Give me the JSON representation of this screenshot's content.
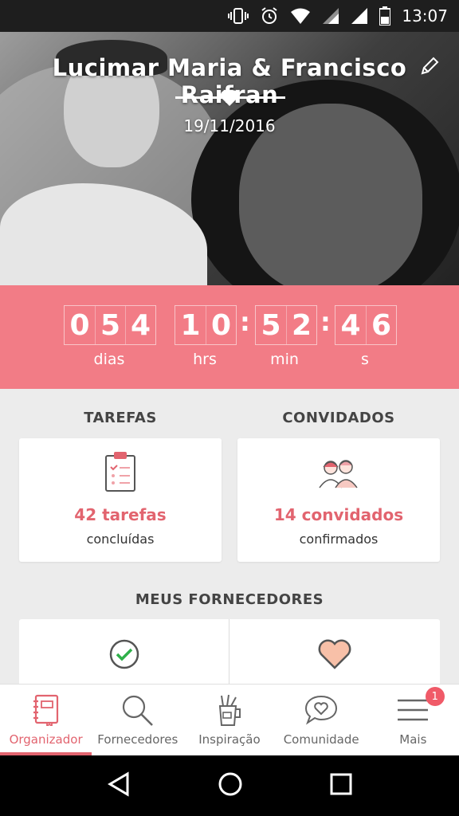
{
  "status_bar": {
    "time": "13:07",
    "icons": [
      "vibrate-icon",
      "alarm-icon",
      "wifi-icon",
      "signal-icon",
      "signal-icon",
      "battery-icon"
    ]
  },
  "hero": {
    "couple_names": "Lucimar Maria & Francisco Raifran",
    "wedding_date": "19/11/2016",
    "photo": "couple-photo"
  },
  "countdown": {
    "days": [
      "0",
      "5",
      "4"
    ],
    "hours": [
      "1",
      "0"
    ],
    "minutes": [
      "5",
      "2"
    ],
    "seconds": [
      "4",
      "6"
    ],
    "labels": {
      "days": "dias",
      "hours": "hrs",
      "minutes": "min",
      "seconds": "s"
    }
  },
  "tasks": {
    "title": "TAREFAS",
    "count": "42 tarefas",
    "subtitle": "concluídas",
    "icon": "clipboard-icon"
  },
  "guests": {
    "title": "CONVIDADOS",
    "count": "14 convidados",
    "subtitle": "confirmados",
    "icon": "guests-icon"
  },
  "vendors": {
    "title": "MEUS FORNECEDORES",
    "left_icon": "check-circle-icon",
    "right_icon": "heart-icon"
  },
  "bottom_nav": {
    "items": [
      {
        "label": "Organizador",
        "icon": "notebook-icon",
        "active": true
      },
      {
        "label": "Fornecedores",
        "icon": "search-icon",
        "active": false
      },
      {
        "label": "Inspiração",
        "icon": "inspiration-cup-icon",
        "active": false
      },
      {
        "label": "Comunidade",
        "icon": "chat-heart-icon",
        "active": false
      },
      {
        "label": "Mais",
        "icon": "menu-icon",
        "active": false
      }
    ],
    "badge": "1"
  },
  "colors": {
    "accent": "#f27c86",
    "accent_text": "#e2646f",
    "badge": "#f05a68"
  }
}
